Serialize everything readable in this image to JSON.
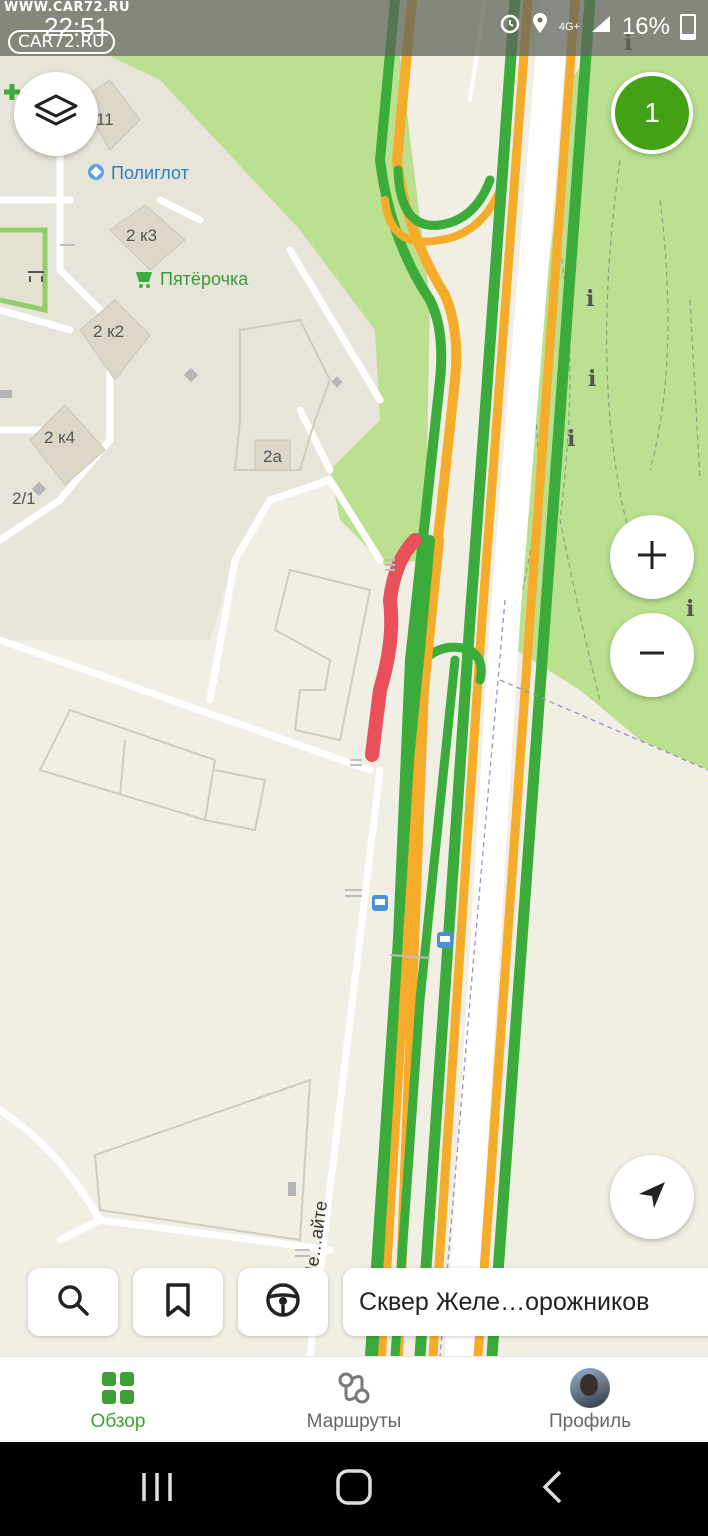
{
  "statusbar": {
    "watermark": "WWW.CAR72.RU",
    "watermark_logo": "CAR72.RU",
    "time": "22:51",
    "network": "4G+",
    "battery": "16%"
  },
  "map": {
    "buttons": {
      "layers_icon": "layers-icon",
      "zoom_in_icon": "plus-icon",
      "zoom_out_icon": "minus-icon",
      "locate_icon": "navigation-arrow-icon"
    },
    "traffic_score": "1",
    "labels": {
      "b11": "11",
      "poliglot": "Полиглот",
      "b2k3": "2 к3",
      "pyaterochka": "Пятёрочка",
      "b2k2": "2 к2",
      "b2k4": "2 к4",
      "b2a": "2а",
      "b21": "2/1",
      "street": "Ме…айте"
    },
    "colors": {
      "road_green": "#3bab3b",
      "road_orange": "#f5ac2b",
      "traffic_red": "#e8505b",
      "park": "#bbe08f",
      "ground": "#f1eee3"
    }
  },
  "toolbar": {
    "search_icon": "search-icon",
    "bookmark_icon": "bookmark-icon",
    "drive_icon": "steering-wheel-icon",
    "place": "Сквер Желе…орожников"
  },
  "bottom_nav": [
    {
      "label": "Обзор",
      "icon": "grid-icon",
      "active": true
    },
    {
      "label": "Маршруты",
      "icon": "routes-icon",
      "active": false
    },
    {
      "label": "Профиль",
      "icon": "avatar",
      "active": false
    }
  ],
  "system_nav": {
    "recents_icon": "recents-icon",
    "home_icon": "home-icon",
    "back_icon": "back-icon"
  }
}
